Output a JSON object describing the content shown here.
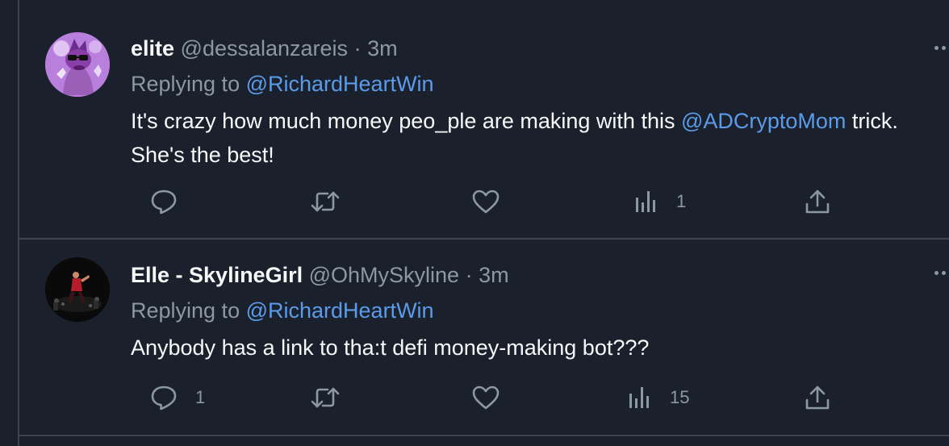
{
  "tweets": [
    {
      "name": "elite",
      "handle": "@dessalanzareis",
      "dot": "·",
      "time": "3m",
      "replying_prefix": "Replying to ",
      "replying_to": "@RichardHeartWin",
      "text_before": "It's crazy how much money peo_ple are making with this ",
      "text_mention": "@ADCryptoMom",
      "text_after": " trick. She's the best!",
      "avatar": "avatar",
      "actions": {
        "reply": {
          "icon": "reply-icon",
          "count": ""
        },
        "retweet": {
          "icon": "retweet-icon",
          "count": ""
        },
        "like": {
          "icon": "like-icon",
          "count": ""
        },
        "views": {
          "icon": "views-icon",
          "count": "1"
        },
        "share": {
          "icon": "share-icon",
          "count": ""
        }
      }
    },
    {
      "name": "Elle - SkylineGirl",
      "handle": "@OhMySkyline",
      "dot": "·",
      "time": "3m",
      "replying_prefix": "Replying to ",
      "replying_to": "@RichardHeartWin",
      "text": "Anybody has a link to tha:t defi money-making bot???",
      "avatar": "avatar",
      "actions": {
        "reply": {
          "icon": "reply-icon",
          "count": "1"
        },
        "retweet": {
          "icon": "retweet-icon",
          "count": ""
        },
        "like": {
          "icon": "like-icon",
          "count": ""
        },
        "views": {
          "icon": "views-icon",
          "count": "15"
        },
        "share": {
          "icon": "share-icon",
          "count": ""
        }
      }
    }
  ],
  "colors": {
    "background": "#1b212c",
    "text": "#f7f9f9",
    "secondary": "#8b98a5",
    "link": "#5b9bea",
    "divider": "#3c4451"
  }
}
